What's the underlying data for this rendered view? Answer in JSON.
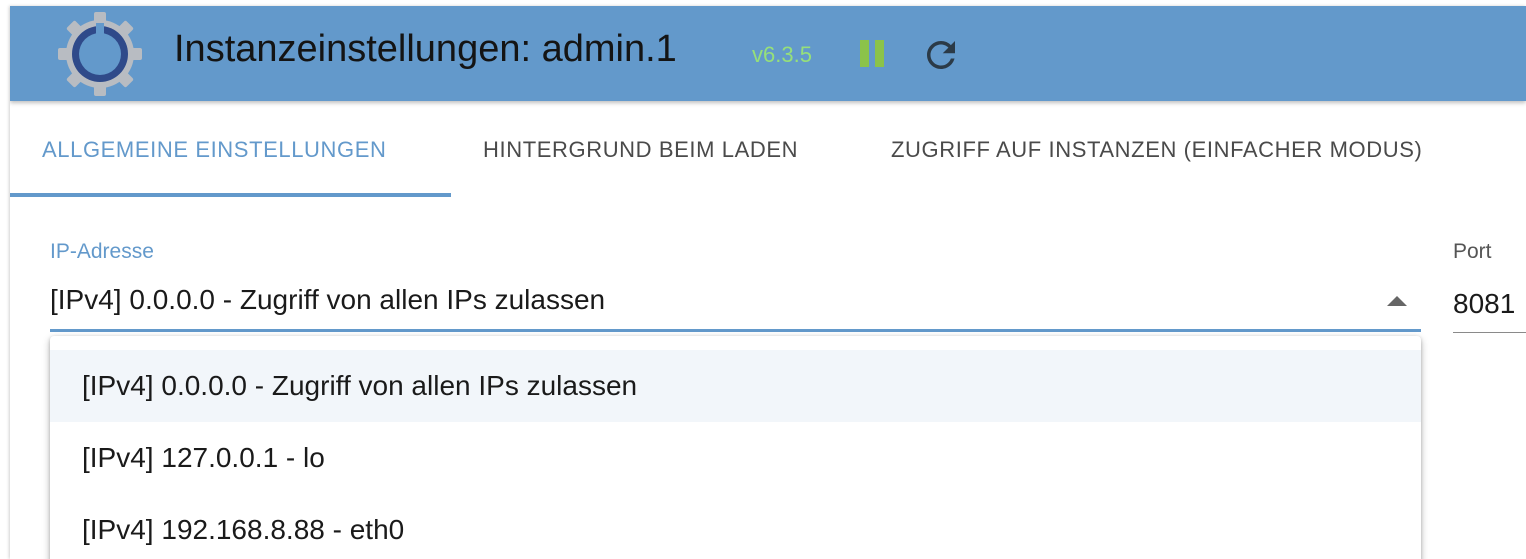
{
  "header": {
    "title": "Instanzeinstellungen: admin.1",
    "version": "v6.3.5",
    "logo_icon": "gear-icon",
    "pause_icon": "pause-icon",
    "reload_icon": "reload-icon",
    "colors": {
      "header_bg": "#6399cb",
      "version_text": "#96e07a",
      "pause_icon": "#8bc34a"
    }
  },
  "tabs": [
    {
      "label": "ALLGEMEINE EINSTELLUNGEN",
      "active": true
    },
    {
      "label": "HINTERGRUND BEIM LADEN",
      "active": false
    },
    {
      "label": "ZUGRIFF AUF INSTANZEN (EINFACHER MODUS)",
      "active": false
    }
  ],
  "form": {
    "ip_address": {
      "label": "IP-Adresse",
      "value": "[IPv4] 0.0.0.0 - Zugriff von allen IPs zulassen",
      "options": [
        "[IPv4] 0.0.0.0 - Zugriff von allen IPs zulassen",
        "[IPv4] 127.0.0.1 - lo",
        "[IPv4] 192.168.8.88 - eth0"
      ]
    },
    "port": {
      "label": "Port",
      "value": "8081"
    }
  },
  "accent_color": "#6399cb"
}
